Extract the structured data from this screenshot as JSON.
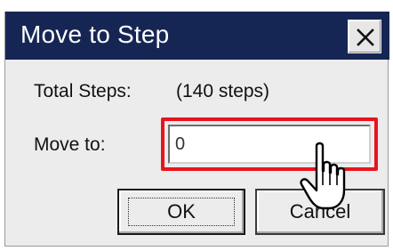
{
  "dialog": {
    "title": "Move to Step",
    "close_symbol": "X"
  },
  "fields": {
    "total_steps_label": "Total Steps:",
    "total_steps_value": "(140 steps)",
    "move_to_label": "Move to:",
    "move_to_value": "0"
  },
  "buttons": {
    "ok_label": "OK",
    "cancel_label": "Cancel"
  },
  "icons": {
    "close": "close-icon",
    "cursor": "hand-pointer-icon"
  },
  "colors": {
    "titlebar": "#162654",
    "highlight": "#e8141c",
    "dialog_bg": "#ececec"
  }
}
